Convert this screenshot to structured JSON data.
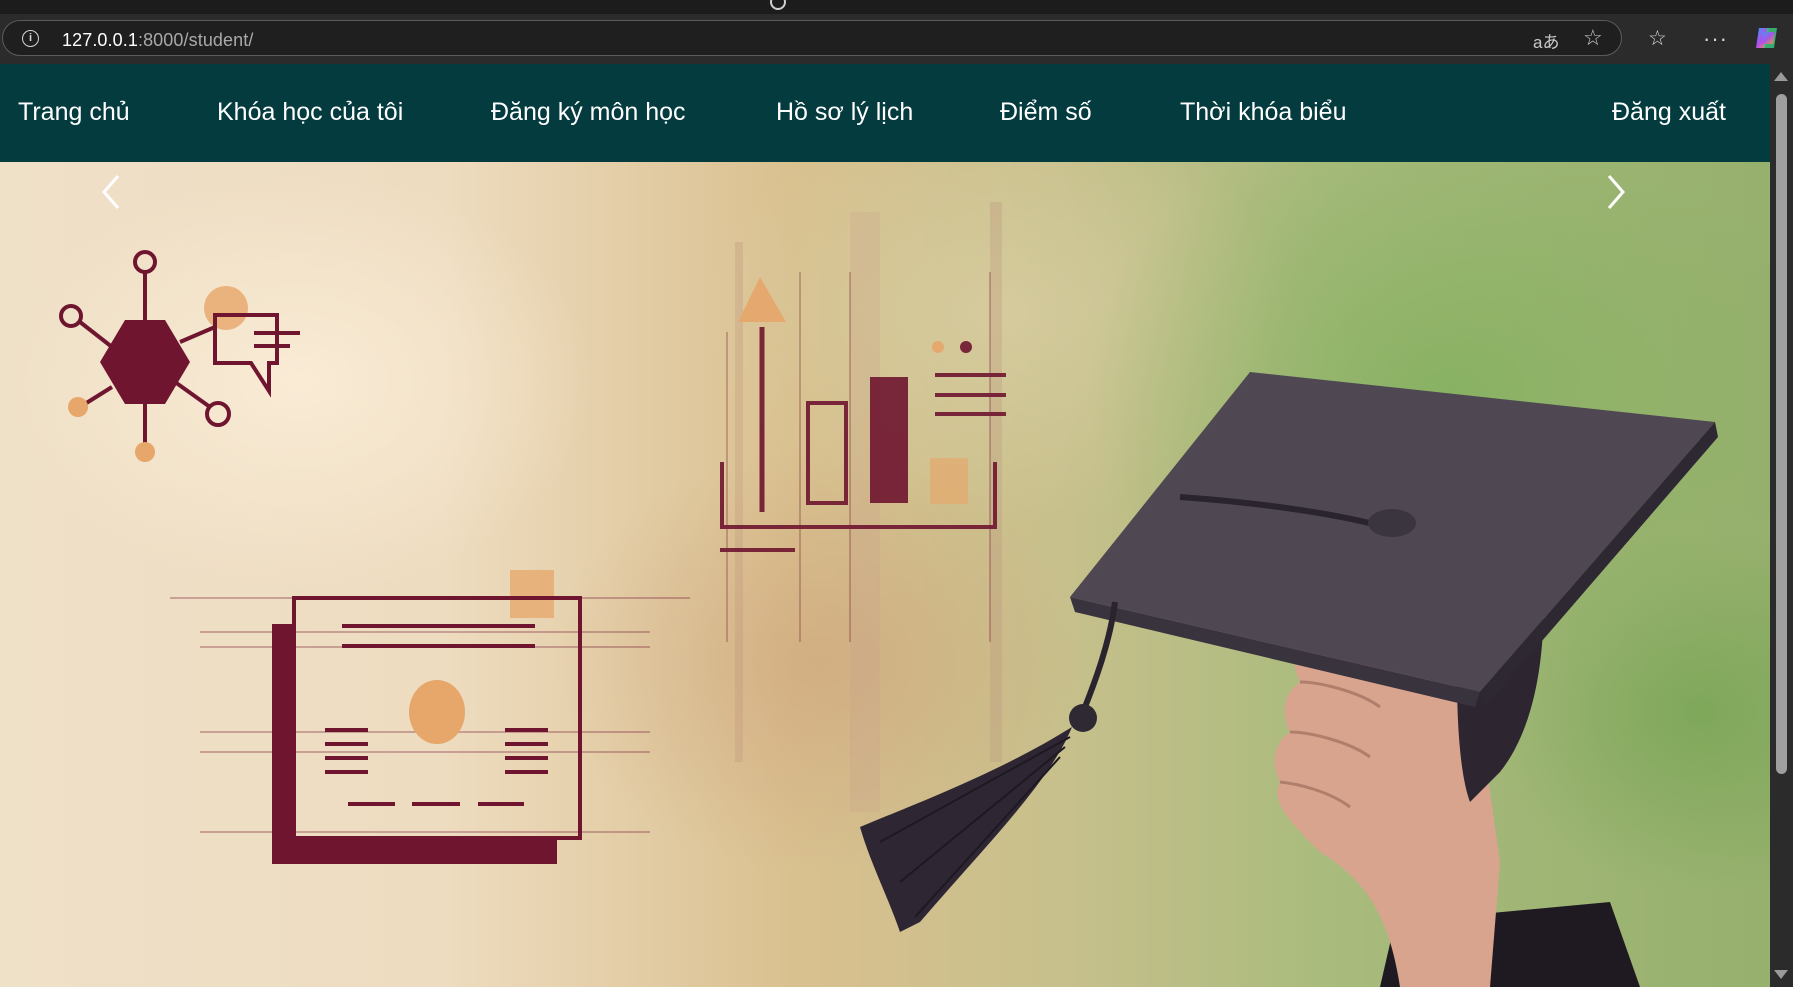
{
  "browser": {
    "url_host": "127.0.0.1",
    "url_path": ":8000/student/",
    "read_aloud_glyph": "aあ",
    "icons": [
      "info-icon",
      "read-aloud-icon",
      "favorite-star-icon",
      "favorites-list-icon",
      "more-menu-icon",
      "copilot-icon"
    ]
  },
  "nav": {
    "home": "Trang chủ",
    "my_courses": "Khóa học của tôi",
    "register": "Đăng ký môn học",
    "profile": "Hồ sơ lý lịch",
    "grades": "Điểm số",
    "timetable": "Thời khóa biểu",
    "logout": "Đăng xuất"
  },
  "colors": {
    "navbar_bg": "#033b3f",
    "icon_maroon": "#6f1530",
    "icon_peach": "#e7a66a"
  },
  "carousel": {
    "icons": [
      "chevron-left-icon",
      "chevron-right-icon"
    ]
  }
}
